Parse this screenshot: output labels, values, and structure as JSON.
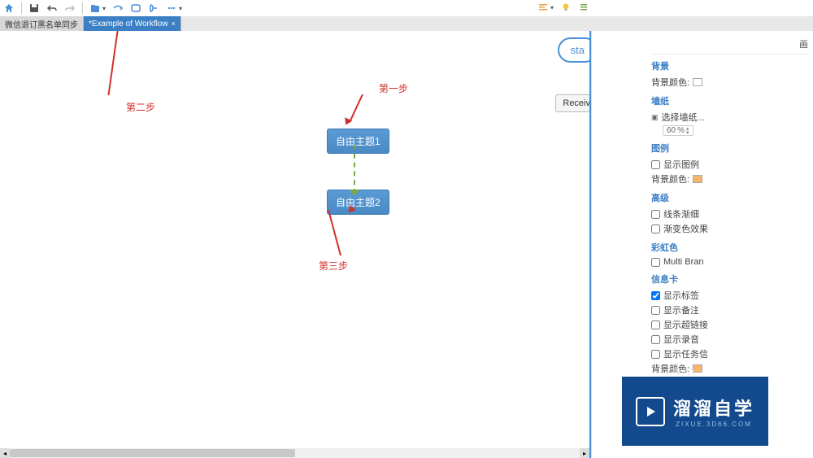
{
  "toolbar": {
    "home_icon": "home",
    "save_icon": "save",
    "undo_icon": "undo",
    "redo_icon": "redo",
    "open_icon": "open",
    "relation_icon": "relation",
    "boundary_icon": "boundary",
    "summary_icon": "summary",
    "more_icon": "more"
  },
  "toolbar_right": {
    "align_icon": "align",
    "bulb_icon": "bulb",
    "list_icon": "list"
  },
  "tabs": [
    {
      "label": "微信退订黑名单同步",
      "active": false
    },
    {
      "label": "*Example of Workflow",
      "active": true
    }
  ],
  "canvas": {
    "start_label": "sta",
    "receive_label": "Receiv",
    "node1": "自由主题1",
    "node2": "自由主题2"
  },
  "annotations": {
    "step1": "第一步",
    "step2": "第二步",
    "step3": "第三步"
  },
  "panel": {
    "header": "画",
    "sections": {
      "background": {
        "title": "背景",
        "bg_color_label": "背景颜色:"
      },
      "wallpaper": {
        "title": "墙纸",
        "select_label": "选择墙纸...",
        "opacity_value": "60",
        "opacity_unit": "%"
      },
      "legend": {
        "title": "图例",
        "show_legend": "显示图例",
        "bg_color_label": "背景颜色:"
      },
      "advanced": {
        "title": "高级",
        "line_taper": "线条渐细",
        "gradient": "渐变色效果"
      },
      "rainbow": {
        "title": "彩虹色",
        "multi_branch": "Multi Bran"
      },
      "info_card": {
        "title": "信息卡",
        "show_label": "显示标签",
        "show_notes": "显示备注",
        "show_link": "显示超链接",
        "show_audio": "显示录音",
        "show_task": "显示任务信",
        "bg_color_label": "背景颜色:"
      }
    }
  },
  "watermark": {
    "main": "溜溜自学",
    "sub": "ZIXUE.3D66.COM"
  }
}
